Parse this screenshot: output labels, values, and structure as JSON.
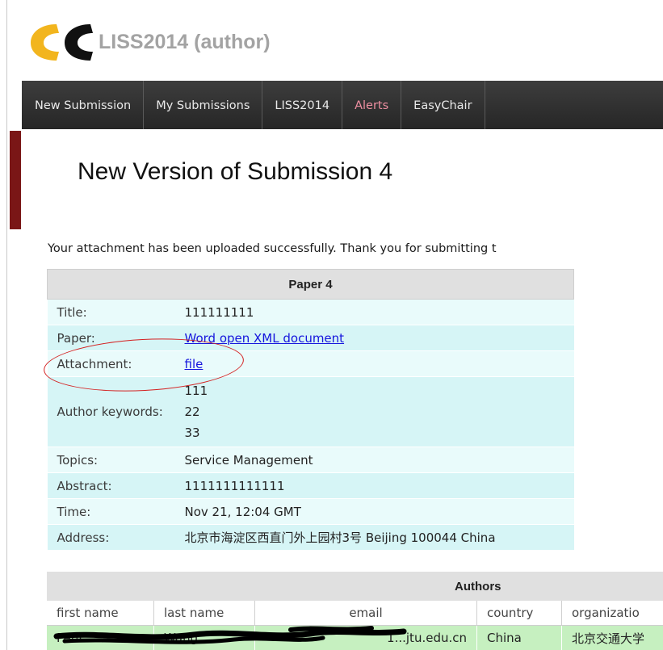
{
  "header": {
    "app_title": "LISS2014 (author)"
  },
  "navbar": {
    "items": [
      {
        "label": "New Submission"
      },
      {
        "label": "My Submissions"
      },
      {
        "label": "LISS2014"
      },
      {
        "label": "Alerts"
      },
      {
        "label": "EasyChair"
      }
    ]
  },
  "page": {
    "title": "New Version of Submission 4",
    "message": "Your attachment has been uploaded successfully. Thank you for submitting t"
  },
  "paper": {
    "caption": "Paper 4",
    "rows": {
      "title": {
        "label": "Title:",
        "value": "111111111"
      },
      "paper": {
        "label": "Paper:",
        "value": "Word open XML document"
      },
      "attachment": {
        "label": "Attachment:",
        "value": "file"
      },
      "keywords": {
        "label": "Author keywords:",
        "values": [
          "111",
          "22",
          "33"
        ]
      },
      "topics": {
        "label": "Topics:",
        "value": "Service Management"
      },
      "abstract": {
        "label": "Abstract:",
        "value": "1111111111111"
      },
      "time": {
        "label": "Time:",
        "value": "Nov 21, 12:04 GMT"
      },
      "address": {
        "label": "Address:",
        "value": "北京市海淀区西直门外上园村3号 Beijing 100044 China"
      }
    }
  },
  "authors": {
    "caption": "Authors",
    "columns": [
      "first name",
      "last name",
      "email",
      "country",
      "organizatio"
    ],
    "row": {
      "first_name": "Penf...",
      "last_name": "Wang",
      "email": "1...jtu.edu.cn",
      "country": "China",
      "organization": "北京交通大学"
    }
  },
  "colors": {
    "navbar": "#2f2f2f",
    "alert_link": "#ee8fa1",
    "accent_bar": "#7a1616",
    "row_light": "#e9fbfb",
    "row_dark": "#d6f5f6",
    "author_row": "#c6f0c0",
    "link": "#1515dd",
    "annotation": "#d42020",
    "logo_yellow": "#f2b51e"
  }
}
